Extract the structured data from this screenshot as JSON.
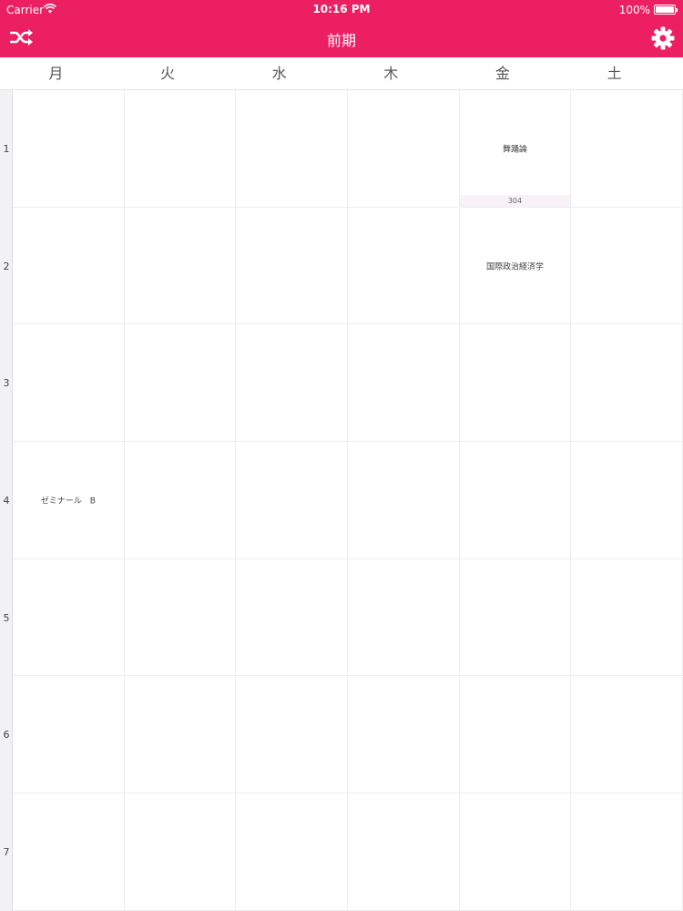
{
  "status": {
    "carrier": "Carrier",
    "time": "10:16 PM",
    "battery": "100%"
  },
  "nav": {
    "title": "前期",
    "left_icon": "shuffle-icon",
    "right_icon": "gear-icon",
    "bar_color": "#ec1f63"
  },
  "days": [
    "月",
    "火",
    "水",
    "木",
    "金",
    "土"
  ],
  "periods": [
    "1",
    "2",
    "3",
    "4",
    "5",
    "6",
    "7"
  ],
  "courses": [
    {
      "day_index": 4,
      "period_index": 0,
      "name": "舞踊論",
      "room": "304"
    },
    {
      "day_index": 4,
      "period_index": 1,
      "name": "国際政治経済学",
      "room": ""
    },
    {
      "day_index": 0,
      "period_index": 3,
      "name": "ゼミナール　B",
      "room": ""
    }
  ]
}
